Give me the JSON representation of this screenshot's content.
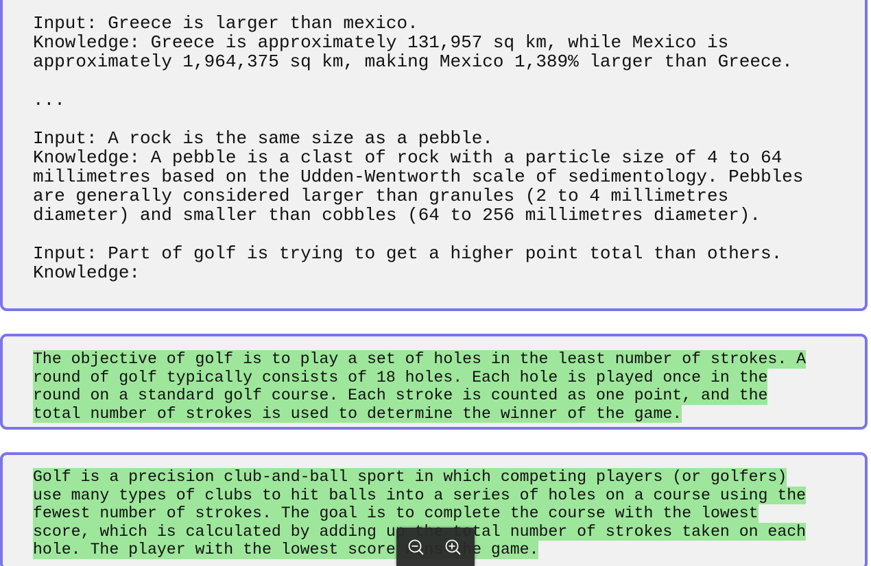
{
  "prompt": {
    "lines": [
      "Input: Greece is larger than mexico.",
      "Knowledge: Greece is approximately 131,957 sq km, while Mexico is",
      "approximately 1,964,375 sq km, making Mexico 1,389% larger than Greece.",
      "",
      "...",
      "",
      "Input: A rock is the same size as a pebble.",
      "Knowledge: A pebble is a clast of rock with a particle size of 4 to 64",
      "millimetres based on the Udden-Wentworth scale of sedimentology. Pebbles",
      "are generally considered larger than granules (2 to 4 millimetres",
      "diameter) and smaller than cobbles (64 to 256 millimetres diameter).",
      "",
      "Input: Part of golf is trying to get a higher point total than others.",
      "Knowledge:"
    ]
  },
  "response_1": {
    "lines": [
      "The objective of golf is to play a set of holes in the least number of strokes. A",
      "round of golf typically consists of 18 holes. Each hole is played once in the",
      "round on a standard golf course. Each stroke is counted as one point, and the",
      "total number of strokes is used to determine the winner of the game."
    ]
  },
  "response_2": {
    "lines": [
      "Golf is a precision club-and-ball sport in which competing players (or golfers)",
      "use many types of clubs to hit balls into a series of holes on a course using the",
      "fewest number of strokes. The goal is to complete the course with the lowest",
      "score, which is calculated by adding up the total number of strokes taken on each",
      "hole. The player with the lowest score wins the game."
    ]
  },
  "colors": {
    "border": "#7a75e8",
    "box_background": "#f1f1f1",
    "highlight": "#9ee69b",
    "zoom_bar": "#2a2a2a"
  },
  "zoom_controls": {
    "zoom_out_icon": "zoom-out-icon",
    "zoom_in_icon": "zoom-in-icon"
  }
}
